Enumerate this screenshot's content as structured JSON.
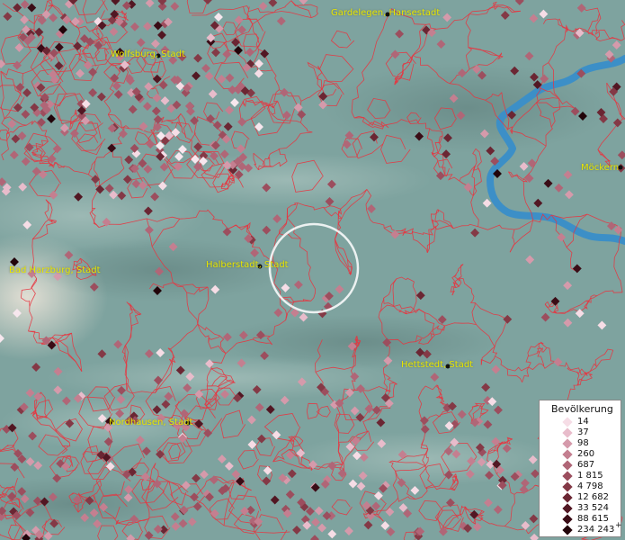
{
  "map": {
    "cities": [
      {
        "name": "Gardelegen, Hansestadt"
      },
      {
        "name": "Wolfsburg, Stadt"
      },
      {
        "name": "Möckern"
      },
      {
        "name": "Bad Harzburg, Stadt"
      },
      {
        "name": "Halberstadt, Stadt"
      },
      {
        "name": "Hettstedt, Stadt"
      },
      {
        "name": "Nordhausen, Stadt"
      }
    ],
    "colors": {
      "terrain": "#7ea39f",
      "borders": "#e8343f",
      "river": "#3c8fc7",
      "labels": "#e8e600"
    }
  },
  "legend": {
    "title": "Bevölkerung",
    "entries": [
      {
        "label": "14",
        "color": "#f6dde6"
      },
      {
        "label": "37",
        "color": "#e8bccb"
      },
      {
        "label": "98",
        "color": "#d59aab"
      },
      {
        "label": "260",
        "color": "#c47f90"
      },
      {
        "label": "687",
        "color": "#b06677"
      },
      {
        "label": "1 815",
        "color": "#9c4e5e"
      },
      {
        "label": "4 798",
        "color": "#843946"
      },
      {
        "label": "12 682",
        "color": "#6b2633"
      },
      {
        "label": "33 524",
        "color": "#521723"
      },
      {
        "label": "88 615",
        "color": "#3a0c16"
      },
      {
        "label": "234 243",
        "color": "#22040a"
      }
    ],
    "plus": "+"
  }
}
